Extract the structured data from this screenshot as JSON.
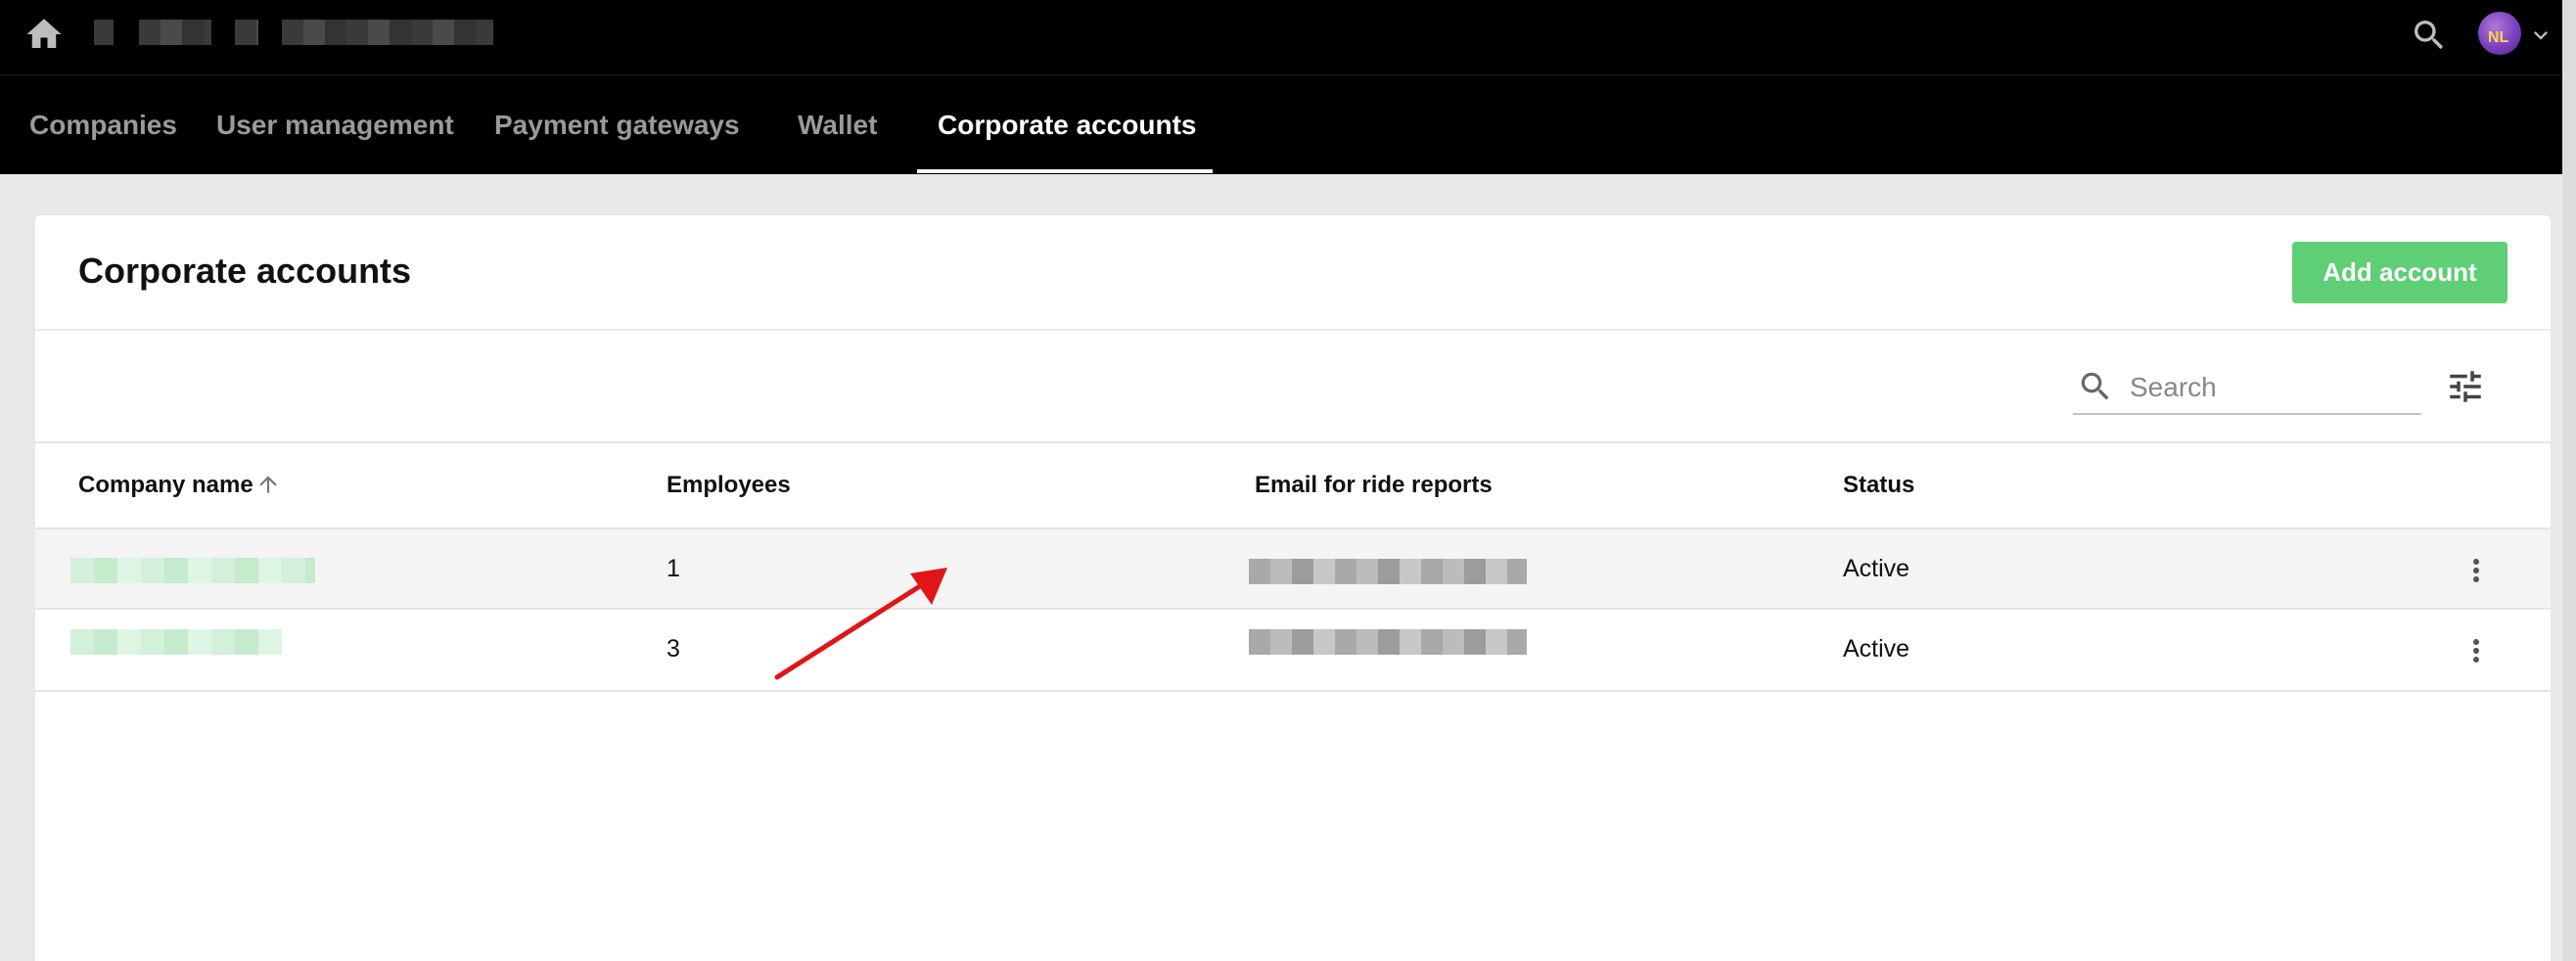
{
  "nav": {
    "tabs": [
      {
        "label": "Companies"
      },
      {
        "label": "User management"
      },
      {
        "label": "Payment gateways"
      },
      {
        "label": "Wallet"
      },
      {
        "label": "Corporate accounts"
      }
    ],
    "active_tab": "Corporate accounts"
  },
  "user": {
    "initials": "NL"
  },
  "page": {
    "title": "Corporate accounts",
    "add_button_label": "Add account"
  },
  "search": {
    "placeholder": "Search"
  },
  "table": {
    "columns": [
      "Company name",
      "Employees",
      "Email for ride reports",
      "Status"
    ],
    "sorted_column": "Company name",
    "sort_direction": "ascending",
    "rows": [
      {
        "employees": "1",
        "status": "Active"
      },
      {
        "employees": "3",
        "status": "Active"
      }
    ]
  },
  "colors": {
    "accent": "#5ecf74",
    "topbar": "#000000",
    "annotation_arrow": "#e01515"
  },
  "icons": [
    "home-icon",
    "search-icon",
    "chevron-down-icon",
    "filter-icon",
    "arrow-up-icon",
    "more-vert-icon"
  ]
}
